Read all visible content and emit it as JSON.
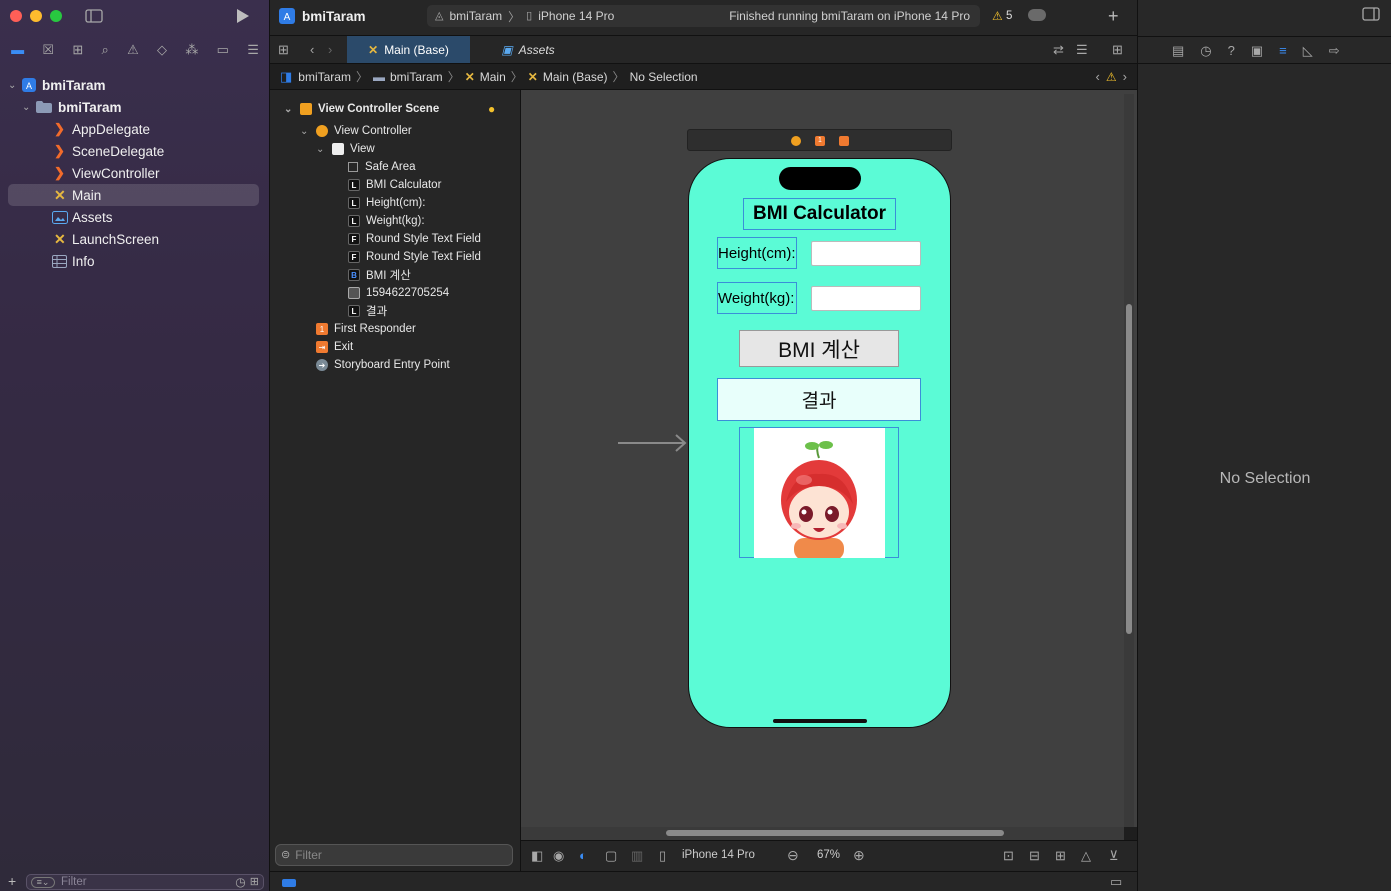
{
  "app": {
    "project_name": "bmiTaram",
    "scheme_target": "bmiTaram",
    "device": "iPhone 14 Pro",
    "run_status": "Finished running bmiTaram on iPhone 14 Pro",
    "warning_count": "5"
  },
  "navigator": {
    "items": [
      {
        "label": "bmiTaram",
        "icon": "project-icon"
      },
      {
        "label": "bmiTaram",
        "icon": "folder-icon"
      },
      {
        "label": "AppDelegate",
        "icon": "swift-file-icon"
      },
      {
        "label": "SceneDelegate",
        "icon": "swift-file-icon"
      },
      {
        "label": "ViewController",
        "icon": "swift-file-icon"
      },
      {
        "label": "Main",
        "icon": "storyboard-icon"
      },
      {
        "label": "Assets",
        "icon": "assets-icon"
      },
      {
        "label": "LaunchScreen",
        "icon": "storyboard-icon"
      },
      {
        "label": "Info",
        "icon": "plist-icon"
      }
    ],
    "filter_placeholder": "Filter"
  },
  "tabs": [
    {
      "label": "Main (Base)",
      "active": true
    },
    {
      "label": "Assets",
      "active": false
    }
  ],
  "breadcrumb": [
    "bmiTaram",
    "bmiTaram",
    "Main",
    "Main (Base)",
    "No Selection"
  ],
  "outline": {
    "scene": "View Controller Scene",
    "view_controller": "View Controller",
    "view": "View",
    "children": [
      {
        "badge": "",
        "label": "Safe Area"
      },
      {
        "badge": "L",
        "label": "BMI Calculator"
      },
      {
        "badge": "L",
        "label": "Height(cm):"
      },
      {
        "badge": "L",
        "label": "Weight(kg):"
      },
      {
        "badge": "F",
        "label": "Round Style Text Field"
      },
      {
        "badge": "F",
        "label": "Round Style Text Field"
      },
      {
        "badge": "B",
        "label": "BMI 계산"
      },
      {
        "badge": "img",
        "label": "1594622705254"
      },
      {
        "badge": "L",
        "label": "결과"
      }
    ],
    "first_responder": "First Responder",
    "exit": "Exit",
    "entry_point": "Storyboard Entry Point",
    "filter_placeholder": "Filter"
  },
  "phone": {
    "title": "BMI Calculator",
    "height_label": "Height(cm):",
    "weight_label": "Weight(kg):",
    "button_label": "BMI 계산",
    "result_label": "결과",
    "background_color": "#5bfbd6"
  },
  "canvas_bar": {
    "device": "iPhone 14 Pro",
    "zoom": "67%"
  },
  "inspector": {
    "empty_text": "No Selection"
  }
}
